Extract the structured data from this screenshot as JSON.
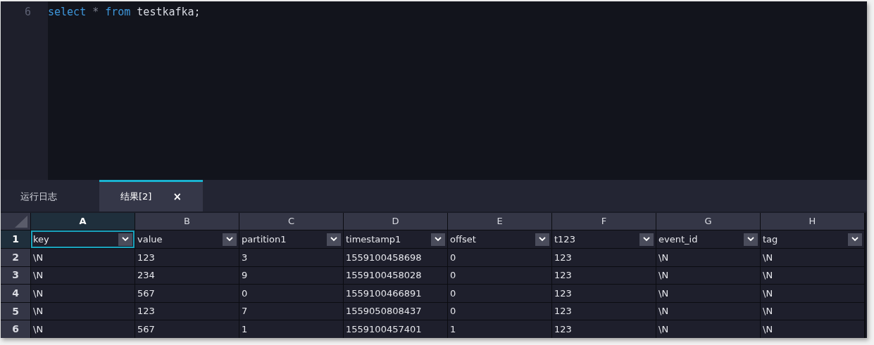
{
  "editor": {
    "lines": [
      {
        "number": "6",
        "tokens": [
          {
            "text": "select",
            "kind": "keyword"
          },
          {
            "text": "*",
            "kind": "operator"
          },
          {
            "text": "from",
            "kind": "keyword"
          },
          {
            "text": "testkafka;",
            "kind": "identifier"
          }
        ]
      }
    ]
  },
  "tabs": [
    {
      "label": "运行日志",
      "selected": false
    },
    {
      "label": "结果[2]",
      "selected": true,
      "close": "×"
    }
  ],
  "grid": {
    "columns": [
      {
        "letter": "A",
        "field": "key",
        "selected": true
      },
      {
        "letter": "B",
        "field": "value",
        "selected": false
      },
      {
        "letter": "C",
        "field": "partition1",
        "selected": false
      },
      {
        "letter": "D",
        "field": "timestamp1",
        "selected": false
      },
      {
        "letter": "E",
        "field": "offset",
        "selected": false
      },
      {
        "letter": "F",
        "field": "t123",
        "selected": false
      },
      {
        "letter": "G",
        "field": "event_id",
        "selected": false
      },
      {
        "letter": "H",
        "field": "tag",
        "selected": false
      }
    ],
    "header_row": {
      "number": "1",
      "selected": true
    },
    "rows": [
      {
        "number": "2",
        "cells": [
          "\\N",
          "123",
          "3",
          "1559100458698",
          "0",
          "123",
          "\\N",
          "\\N"
        ]
      },
      {
        "number": "3",
        "cells": [
          "\\N",
          "234",
          "9",
          "1559100458028",
          "0",
          "123",
          "\\N",
          "\\N"
        ]
      },
      {
        "number": "4",
        "cells": [
          "\\N",
          "567",
          "0",
          "1559100466891",
          "0",
          "123",
          "\\N",
          "\\N"
        ]
      },
      {
        "number": "5",
        "cells": [
          "\\N",
          "123",
          "7",
          "1559050808437",
          "0",
          "123",
          "\\N",
          "\\N"
        ]
      },
      {
        "number": "6",
        "cells": [
          "\\N",
          "567",
          "1",
          "1559100457401",
          "1",
          "123",
          "\\N",
          "\\N"
        ]
      }
    ]
  }
}
